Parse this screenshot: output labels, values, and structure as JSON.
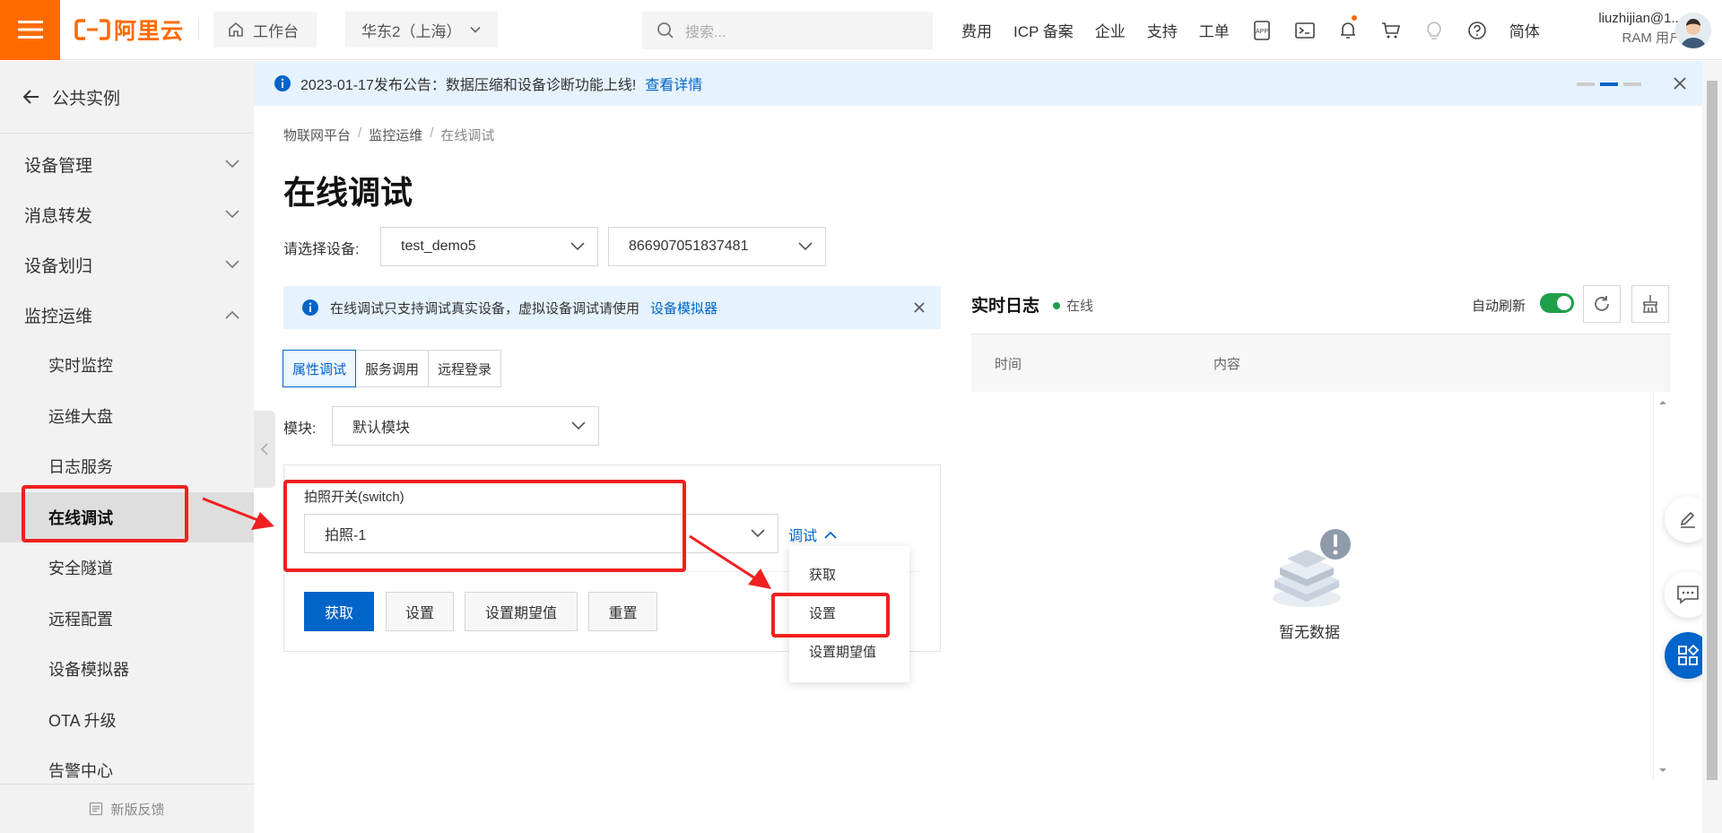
{
  "topbar": {
    "logo_text": "阿里云",
    "workbench": "工作台",
    "region": "华东2（上海）",
    "search_placeholder": "搜索...",
    "nav_links": [
      "费用",
      "ICP 备案",
      "企业",
      "支持",
      "工单"
    ],
    "language": "简体",
    "user_name": "liuzhijian@1...",
    "user_role": "RAM 用户",
    "accent_color": "#ff6a00"
  },
  "sidebar": {
    "back_label": "公共实例",
    "groups": [
      {
        "label": "设备管理",
        "expanded": false
      },
      {
        "label": "消息转发",
        "expanded": false
      },
      {
        "label": "设备划归",
        "expanded": false
      },
      {
        "label": "监控运维",
        "expanded": true
      }
    ],
    "items": [
      "实时监控",
      "运维大盘",
      "日志服务",
      "在线调试",
      "安全隧道",
      "远程配置",
      "设备模拟器",
      "OTA 升级",
      "告警中心"
    ],
    "active_item": "在线调试",
    "feedback": "新版反馈"
  },
  "announcement": {
    "text": "2023-01-17发布公告：数据压缩和设备诊断功能上线!",
    "link": "查看详情"
  },
  "breadcrumb": [
    "物联网平台",
    "监控运维",
    "在线调试"
  ],
  "page_title": "在线调试",
  "device": {
    "label": "请选择设备:",
    "product": "test_demo5",
    "device_id": "866907051837481"
  },
  "tip": {
    "text": "在线调试只支持调试真实设备，虚拟设备调试请使用",
    "link": "设备模拟器"
  },
  "tabs": [
    "属性调试",
    "服务调用",
    "远程登录"
  ],
  "active_tab": "属性调试",
  "module": {
    "label": "模块:",
    "value": "默认模块"
  },
  "property": {
    "label": "拍照开关(switch)",
    "value": "拍照-1",
    "debug_link": "调试"
  },
  "actions": {
    "get": "获取",
    "set": "设置",
    "set_expected": "设置期望值",
    "reset": "重置"
  },
  "debug_menu": [
    "获取",
    "设置",
    "设置期望值"
  ],
  "log": {
    "title": "实时日志",
    "status": "在线",
    "auto_refresh_label": "自动刷新",
    "auto_refresh_on": true,
    "columns": [
      "时间",
      "内容"
    ],
    "empty": "暂无数据"
  },
  "colors": {
    "primary": "#0064c8",
    "online": "#1ea04b",
    "annotation": "#f02020"
  }
}
